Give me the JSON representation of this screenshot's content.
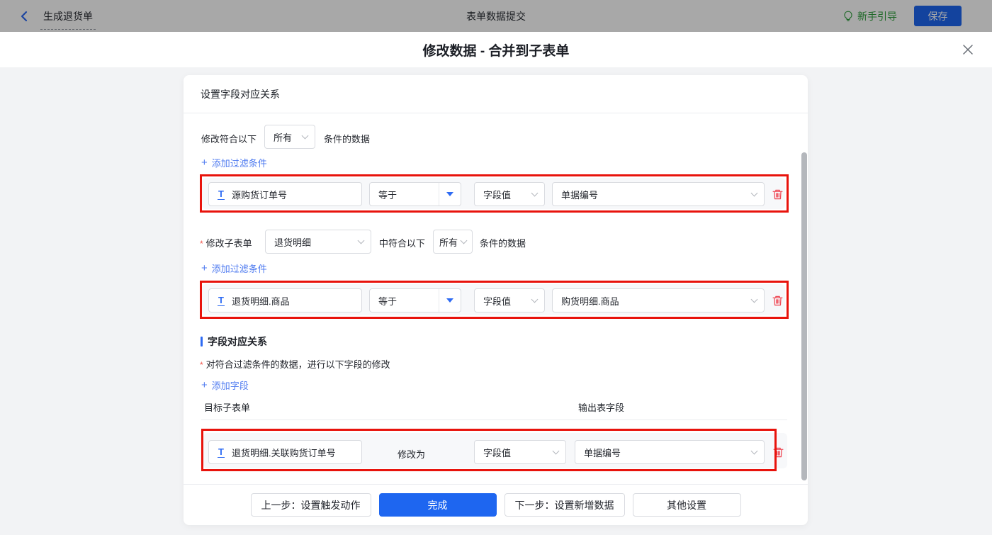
{
  "topbar": {
    "back_label": "生成退货单",
    "title": "表单数据提交",
    "guide_label": "新手引导",
    "save_label": "保存"
  },
  "modal": {
    "title": "修改数据 - 合并到子表单"
  },
  "panel": {
    "header": "设置字段对应关系",
    "filter_main": {
      "prefix": "修改符合以下",
      "match": "所有",
      "suffix": "条件的数据",
      "add_label": "添加过滤条件"
    },
    "condition1": {
      "field": "源购货订单号",
      "operator": "等于",
      "value_type": "字段值",
      "value": "单据编号"
    },
    "subform_filter": {
      "label": "修改子表单",
      "subform": "退货明细",
      "mid": "中符合以下",
      "match": "所有",
      "suffix": "条件的数据",
      "add_label": "添加过滤条件"
    },
    "condition2": {
      "field": "退货明细.商品",
      "operator": "等于",
      "value_type": "字段值",
      "value": "购货明细.商品"
    },
    "mapping": {
      "title": "字段对应关系",
      "desc": "对符合过滤条件的数据，进行以下字段的修改",
      "add_label": "添加字段",
      "col_target": "目标子表单",
      "col_output": "输出表字段"
    },
    "mapping_row": {
      "field": "退货明细.关联购货订单号",
      "action": "修改为",
      "value_type": "字段值",
      "value": "单据编号"
    }
  },
  "footer": {
    "prev": "上一步：设置触发动作",
    "done": "完成",
    "next": "下一步：设置新增数据",
    "other": "其他设置"
  },
  "symbols": {
    "plus": "+",
    "required": "*",
    "text_field_icon": "T"
  },
  "colors": {
    "accent_blue": "#1e66f0",
    "link_blue": "#4f7bf0",
    "annotation_red": "#e8130c",
    "trash_red": "#ef4b57",
    "guide_green": "#2d9e3a",
    "page_bg": "#f2f3f5"
  }
}
